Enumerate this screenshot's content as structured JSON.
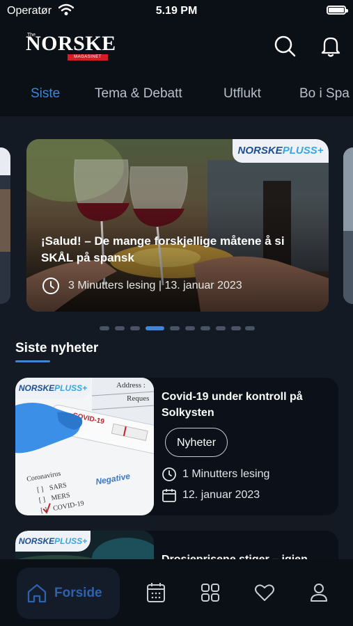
{
  "status_bar": {
    "carrier": "Operatør",
    "time": "5.19 PM"
  },
  "header": {
    "logo": {
      "the": "The",
      "name": "NORSKE",
      "sub": "MAGASINET"
    },
    "icons": [
      "search-icon",
      "bell-icon"
    ]
  },
  "tabs": [
    {
      "label": "Siste",
      "active": true
    },
    {
      "label": "Tema & Debatt",
      "active": false
    },
    {
      "label": "Utflukt",
      "active": false
    },
    {
      "label": "Bo i Spa",
      "active": false
    }
  ],
  "featured": {
    "badge_a": "NORSKE",
    "badge_b": "PLUSS+",
    "title": "¡Salud! – De mange forskjellige måtene å si SKÅL på spansk",
    "meta": "3  Minutters lesing | 13. januar 2023"
  },
  "carousel": {
    "total": 10,
    "active_index": 3
  },
  "section": {
    "title": "Siste nyheter"
  },
  "news": [
    {
      "badge_a": "NORSKE",
      "badge_b": "PLUSS+",
      "title": "Covid-19 under kontroll på Solkysten",
      "category": "Nyheter",
      "read_time": "1 Minutters lesing",
      "date": "12. januar 2023",
      "thumb_text": {
        "address": "Address :",
        "requests": "Reques",
        "covid_tube": "COVID-19",
        "coronavirus": "Coronavirus",
        "sars": "SARS",
        "mers": "MERS",
        "covid": "COVID-19",
        "negative": "Negative"
      }
    },
    {
      "badge_a": "NORSKE",
      "badge_b": "PLUSS+",
      "title": "Drosjeprisene stiger – igjen"
    }
  ],
  "bottom_nav": {
    "items": [
      {
        "label": "Forside",
        "icon": "home-icon",
        "active": true
      },
      {
        "icon": "calendar-icon"
      },
      {
        "icon": "grid-icon"
      },
      {
        "icon": "heart-icon"
      },
      {
        "icon": "user-icon"
      }
    ]
  },
  "colors": {
    "accent": "#3f86d6",
    "background": "#141a24",
    "bar": "#0b0f16",
    "logo_red": "#d81c23"
  }
}
